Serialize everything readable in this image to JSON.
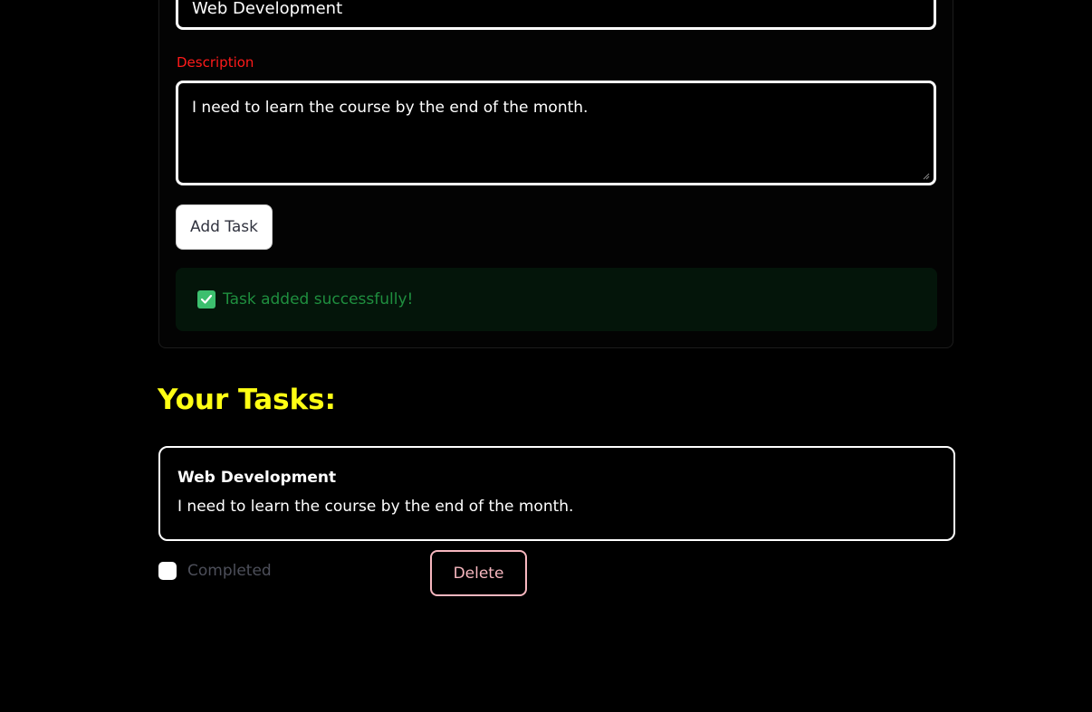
{
  "form": {
    "title_value": "Web Development",
    "description_label": "Description",
    "description_value": "I need to learn the course by the end of the month.",
    "add_button_label": "Add Task",
    "success_message": "Task added successfully!"
  },
  "tasks": {
    "heading": "Your Tasks:",
    "items": [
      {
        "title": "Web Development",
        "description": "I need to learn the course by the end of the month.",
        "completed_label": "Completed",
        "completed": false,
        "delete_label": "Delete"
      }
    ]
  },
  "colors": {
    "background": "#000000",
    "label_red": "#ff1a1a",
    "heading_yellow": "#ffff14",
    "success_bg": "#04150a",
    "success_text": "#1f8f3f",
    "delete_pink": "#f7b7bf"
  },
  "icons": {
    "success": "check-square-icon",
    "resize": "resize-grip-icon"
  }
}
